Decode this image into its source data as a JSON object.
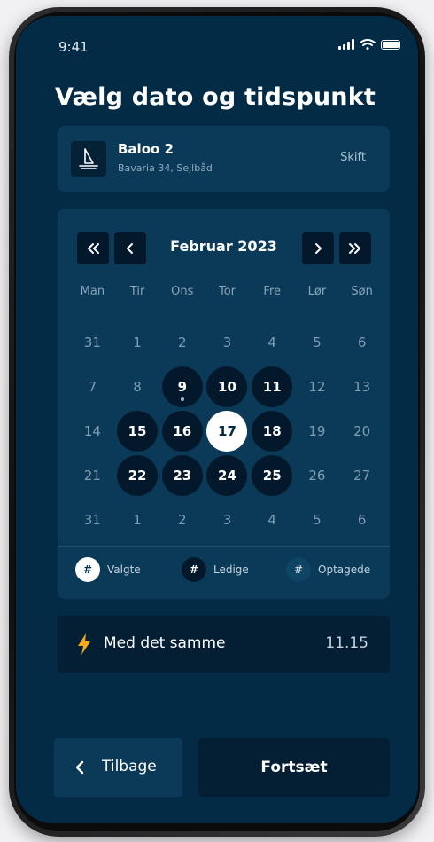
{
  "status_bar": {
    "time": "9:41"
  },
  "title": "Vælg dato og tidspunkt",
  "boat": {
    "name": "Baloo 2",
    "details": "Bavaria 34, Sejlbåd",
    "change_label": "Skift"
  },
  "calendar": {
    "month": "Februar 2023",
    "weekdays": [
      "Man",
      "Tir",
      "Ons",
      "Tor",
      "Fre",
      "Lør",
      "Søn"
    ],
    "weeks": [
      [
        {
          "d": "31",
          "s": "inactive"
        },
        {
          "d": "1",
          "s": "inactive"
        },
        {
          "d": "2",
          "s": "inactive"
        },
        {
          "d": "3",
          "s": "inactive"
        },
        {
          "d": "4",
          "s": "inactive"
        },
        {
          "d": "5",
          "s": "inactive"
        },
        {
          "d": "6",
          "s": "inactive"
        }
      ],
      [
        {
          "d": "7",
          "s": "inactive"
        },
        {
          "d": "8",
          "s": "inactive"
        },
        {
          "d": "9",
          "s": "available",
          "dot": true
        },
        {
          "d": "10",
          "s": "available"
        },
        {
          "d": "11",
          "s": "available"
        },
        {
          "d": "12",
          "s": "inactive"
        },
        {
          "d": "13",
          "s": "inactive"
        }
      ],
      [
        {
          "d": "14",
          "s": "inactive"
        },
        {
          "d": "15",
          "s": "available"
        },
        {
          "d": "16",
          "s": "available"
        },
        {
          "d": "17",
          "s": "selected"
        },
        {
          "d": "18",
          "s": "available"
        },
        {
          "d": "19",
          "s": "inactive"
        },
        {
          "d": "20",
          "s": "inactive"
        }
      ],
      [
        {
          "d": "21",
          "s": "inactive"
        },
        {
          "d": "22",
          "s": "available"
        },
        {
          "d": "23",
          "s": "available"
        },
        {
          "d": "24",
          "s": "available"
        },
        {
          "d": "25",
          "s": "available"
        },
        {
          "d": "26",
          "s": "inactive"
        },
        {
          "d": "27",
          "s": "inactive"
        }
      ],
      [
        {
          "d": "31",
          "s": "inactive"
        },
        {
          "d": "1",
          "s": "inactive"
        },
        {
          "d": "2",
          "s": "inactive"
        },
        {
          "d": "3",
          "s": "inactive"
        },
        {
          "d": "4",
          "s": "inactive"
        },
        {
          "d": "5",
          "s": "inactive"
        },
        {
          "d": "6",
          "s": "inactive"
        }
      ]
    ],
    "legend": [
      {
        "symbol": "#",
        "label": "Valgte",
        "kind": "selected"
      },
      {
        "symbol": "#",
        "label": "Ledige",
        "kind": "available"
      },
      {
        "symbol": "#",
        "label": "Optagede",
        "kind": "booked"
      }
    ],
    "nav_icons": [
      "double-chevron-left-icon",
      "chevron-left-icon",
      "chevron-right-icon",
      "double-chevron-right-icon"
    ]
  },
  "quick_option": {
    "label": "Med det samme",
    "time": "11.15",
    "icon": "lightning-icon"
  },
  "footer": {
    "back_label": "Tilbage",
    "continue_label": "Fortsæt"
  },
  "colors": {
    "background": "#042b45",
    "card": "#0b3a58",
    "dark": "#03192b",
    "accent": "#f6a91f",
    "selected": "#ffffff"
  }
}
